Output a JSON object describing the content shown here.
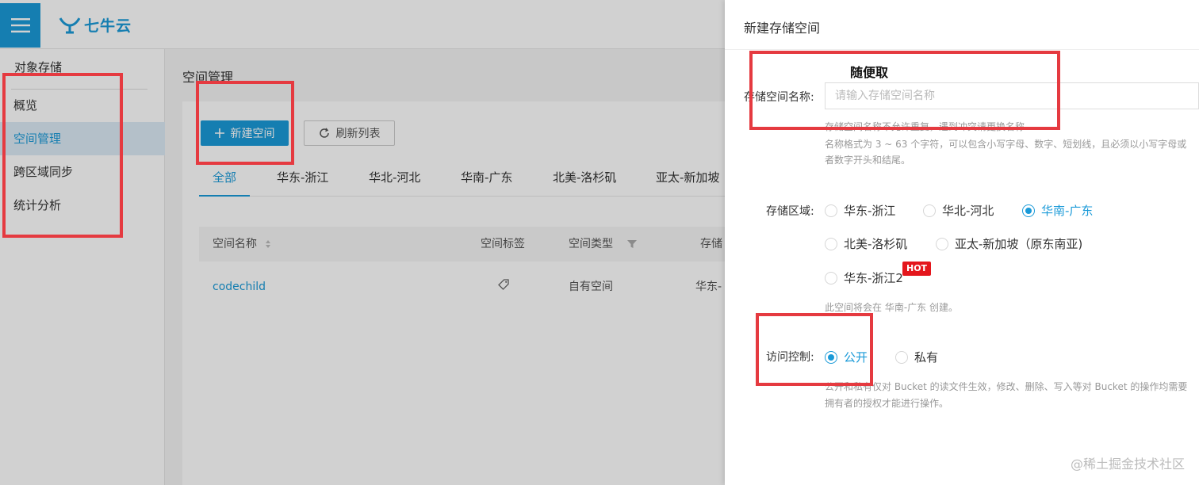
{
  "header": {
    "logo_text": "七牛云"
  },
  "sidebar": {
    "title": "对象存储",
    "items": [
      {
        "label": "概览"
      },
      {
        "label": "空间管理"
      },
      {
        "label": "跨区域同步"
      },
      {
        "label": "统计分析"
      }
    ]
  },
  "main": {
    "title": "空间管理",
    "new_button": "新建空间",
    "refresh_button": "刷新列表",
    "tabs": [
      "全部",
      "华东-浙江",
      "华北-河北",
      "华南-广东",
      "北美-洛杉矶",
      "亚太-新加坡"
    ],
    "columns": [
      "空间名称",
      "空间标签",
      "空间类型",
      "存储"
    ],
    "rows": [
      {
        "name": "codechild",
        "type": "自有空间",
        "region": "华东-"
      }
    ]
  },
  "drawer": {
    "title": "新建存储空间",
    "annotation": "随便取",
    "name_label": "存储空间名称:",
    "name_placeholder": "请输入存储空间名称",
    "name_hint_1": "存储空间名称不允许重复，遇到冲突请更换名称",
    "name_hint_2": "名称格式为 3 ~ 63 个字符，可以包含小写字母、数字、短划线，且必须以小写字母或",
    "name_hint_3": "者数字开头和结尾。",
    "region_label": "存储区域:",
    "regions": [
      "华东-浙江",
      "华北-河北",
      "华南-广东",
      "北美-洛杉矶",
      "亚太-新加坡（原东南亚)",
      "华东-浙江2"
    ],
    "hot_badge": "HOT",
    "region_hint": "此空间将会在 华南-广东 创建。",
    "access_label": "访问控制:",
    "access_options": [
      "公开",
      "私有"
    ],
    "access_hint_1": "公开和私有仅对 Bucket 的读文件生效，修改、删除、写入等对 Bucket 的操作均需要",
    "access_hint_2": "拥有者的授权才能进行操作。",
    "selected_region": "华南-广东",
    "selected_access": "公开"
  },
  "watermark": "@稀土掘金技术社区",
  "colors": {
    "accent": "#1a9ad8",
    "annotation": "#e53a40",
    "hot": "#e4161c"
  }
}
